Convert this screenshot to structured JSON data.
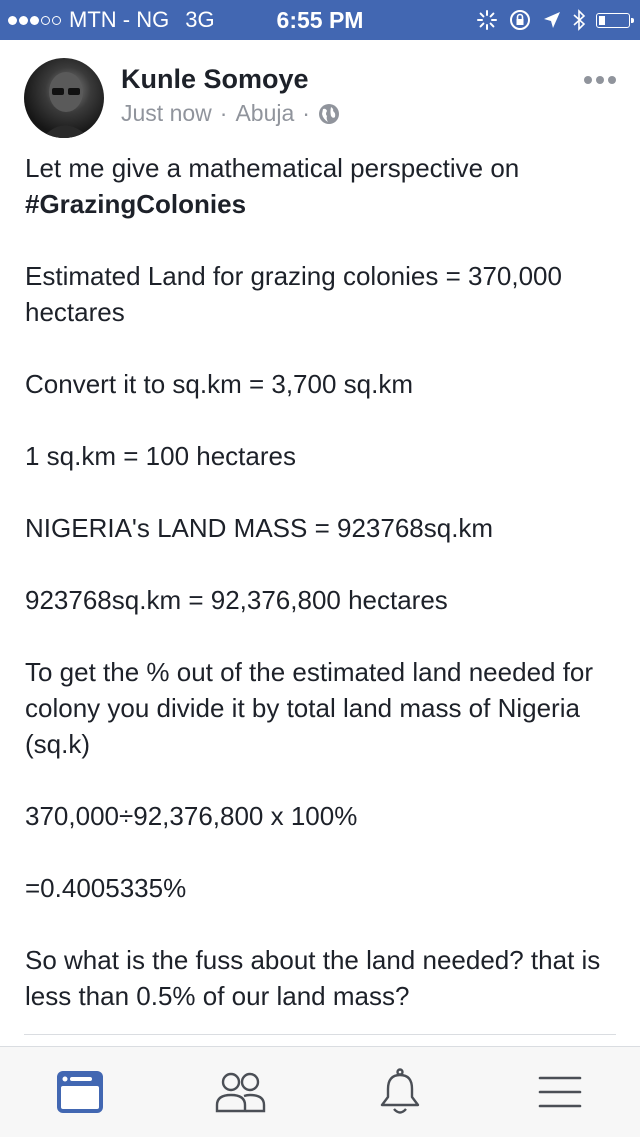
{
  "status_bar": {
    "carrier": "MTN - NG",
    "network": "3G",
    "time": "6:55 PM"
  },
  "post": {
    "author": "Kunle Somoye",
    "timestamp": "Just now",
    "location": "Abuja",
    "separator": "·",
    "privacy_icon": "globe-icon",
    "more_icon": "more-options-icon",
    "intro": "Let me give a mathematical perspective on",
    "hashtag": "#GrazingColonies",
    "paragraphs": [
      "Estimated Land for grazing colonies = 370,000 hectares",
      "Convert it to sq.km = 3,700 sq.km",
      "1 sq.km = 100 hectares",
      "NIGERIA's LAND MASS = 923768sq.km",
      "923768sq.km = 92,376,800 hectares",
      "To get the % out of the estimated land needed for colony you divide it by total land mass of Nigeria (sq.k)",
      "370,000÷92,376,800 x 100%",
      "=0.4005335%",
      "So what is the fuss about the land needed? that is less than 0.5% of our land mass?"
    ]
  },
  "tab_bar": {
    "tabs": [
      "news-feed-icon",
      "friends-icon",
      "notifications-icon",
      "menu-icon"
    ],
    "active_color": "#4267b2",
    "inactive_color": "#4b4f56"
  },
  "colors": {
    "brand_blue": "#4267b2",
    "text": "#1d2129",
    "secondary_text": "#90949c"
  }
}
